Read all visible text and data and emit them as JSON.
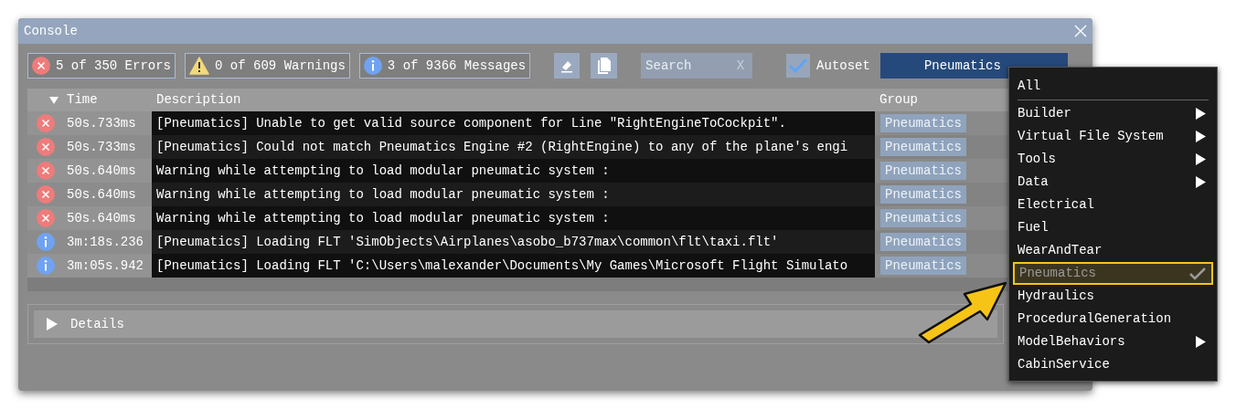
{
  "window": {
    "title": "Console"
  },
  "filters": [
    {
      "kind": "error",
      "label": "5 of 350 Errors"
    },
    {
      "kind": "warning",
      "label": "0 of 609 Warnings"
    },
    {
      "kind": "info",
      "label": "3 of 9366 Messages"
    }
  ],
  "search": {
    "placeholder": "Search",
    "clear": "X"
  },
  "autoset": {
    "label": "Autoset",
    "checked": true
  },
  "group_dropdown": {
    "value": "Pneumatics"
  },
  "table": {
    "columns": [
      "Time",
      "Description",
      "Group"
    ],
    "rows": [
      {
        "kind": "error",
        "time": "50s.733ms",
        "description": "[Pneumatics] Unable to get valid source component for Line \"RightEngineToCockpit\".",
        "group": "Pneumatics"
      },
      {
        "kind": "error",
        "time": "50s.733ms",
        "description": "[Pneumatics] Could not match Pneumatics Engine #2 (RightEngine) to any of the plane's engi",
        "group": "Pneumatics"
      },
      {
        "kind": "error",
        "time": "50s.640ms",
        "description": "Warning while attempting to load modular pneumatic system :",
        "group": "Pneumatics"
      },
      {
        "kind": "error",
        "time": "50s.640ms",
        "description": "Warning while attempting to load modular pneumatic system :",
        "group": "Pneumatics"
      },
      {
        "kind": "error",
        "time": "50s.640ms",
        "description": "Warning while attempting to load modular pneumatic system :",
        "group": "Pneumatics"
      },
      {
        "kind": "info",
        "time": "3m:18s.236",
        "description": "[Pneumatics] Loading FLT 'SimObjects\\Airplanes\\asobo_b737max\\common\\flt\\taxi.flt'",
        "group": "Pneumatics"
      },
      {
        "kind": "info",
        "time": "3m:05s.942",
        "description": "[Pneumatics] Loading FLT 'C:\\Users\\malexander\\Documents\\My Games\\Microsoft Flight Simulato",
        "group": "Pneumatics"
      }
    ]
  },
  "details": {
    "label": "Details",
    "expanded": false
  },
  "menu": {
    "first": "All",
    "items": [
      {
        "label": "Builder",
        "submenu": true,
        "selected": false
      },
      {
        "label": "Virtual File System",
        "submenu": true,
        "selected": false
      },
      {
        "label": "Tools",
        "submenu": true,
        "selected": false
      },
      {
        "label": "Data",
        "submenu": true,
        "selected": false
      },
      {
        "label": "Electrical",
        "submenu": false,
        "selected": false
      },
      {
        "label": "Fuel",
        "submenu": false,
        "selected": false
      },
      {
        "label": "WearAndTear",
        "submenu": false,
        "selected": false
      },
      {
        "label": "Pneumatics",
        "submenu": false,
        "selected": true
      },
      {
        "label": "Hydraulics",
        "submenu": false,
        "selected": false
      },
      {
        "label": "ProceduralGeneration",
        "submenu": false,
        "selected": false
      },
      {
        "label": "ModelBehaviors",
        "submenu": true,
        "selected": false
      },
      {
        "label": "CabinService",
        "submenu": false,
        "selected": false
      }
    ]
  }
}
